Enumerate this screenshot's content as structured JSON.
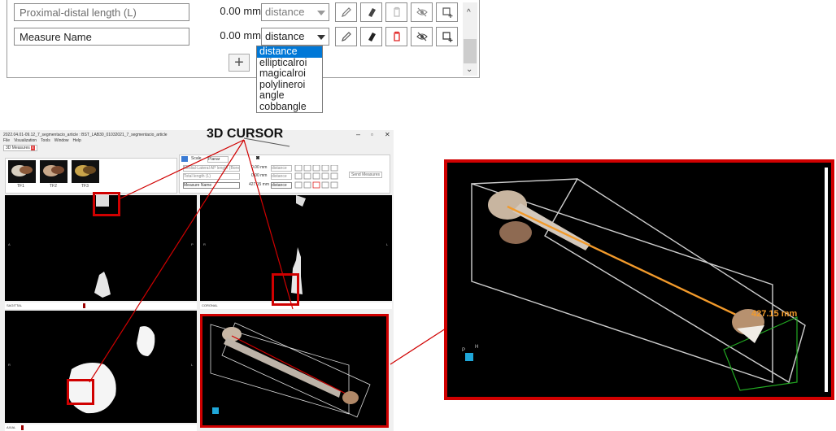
{
  "measure_panel": {
    "rows": [
      {
        "name": "Proximal-distal length (L)",
        "value": "0.00 mm",
        "type": "distance"
      },
      {
        "name": "Measure Name",
        "value": "0.00 mm",
        "type": "distance"
      }
    ],
    "add_label": "+",
    "dropdown_options": [
      "distance",
      "ellipticalroi",
      "magicalroi",
      "polylineroi",
      "angle",
      "cobbangle"
    ],
    "selected_option": "distance"
  },
  "annotation": {
    "title": "3D CURSOR",
    "distance_label": "427.15 mm"
  },
  "app": {
    "title": "2022.04.01-09.12_7_segmentacio_article : BST_LAB30_01032021_7_segmentacio_article",
    "menu": [
      "File",
      "Visualization",
      "Tools",
      "Window",
      "Help"
    ],
    "tab": "3D Measures",
    "thumbnails": [
      "TF1",
      "TF2",
      "TF3"
    ],
    "toolbar_labels": {
      "scale": "Scale",
      "planar": "Planar"
    },
    "mini_rows": [
      {
        "name": "Medial-Lateral AP length (Bone)",
        "value": "0.00 mm",
        "type": "distance"
      },
      {
        "name": "Total length (L)",
        "value": "0.00 mm",
        "type": "distance"
      },
      {
        "name": "Measure Name",
        "value": "427.15 mm",
        "type": "distance"
      }
    ],
    "send_button": "Send Measures",
    "views": {
      "sagittal": "SAGITTAL",
      "coronal": "CORONAL",
      "axial": "AXIAL"
    },
    "window_controls": [
      "–",
      "▫",
      "✕"
    ]
  },
  "colors": {
    "highlight_red": "#d00000",
    "measure_orange": "#f29a2b",
    "selection_blue": "#0078d7"
  }
}
